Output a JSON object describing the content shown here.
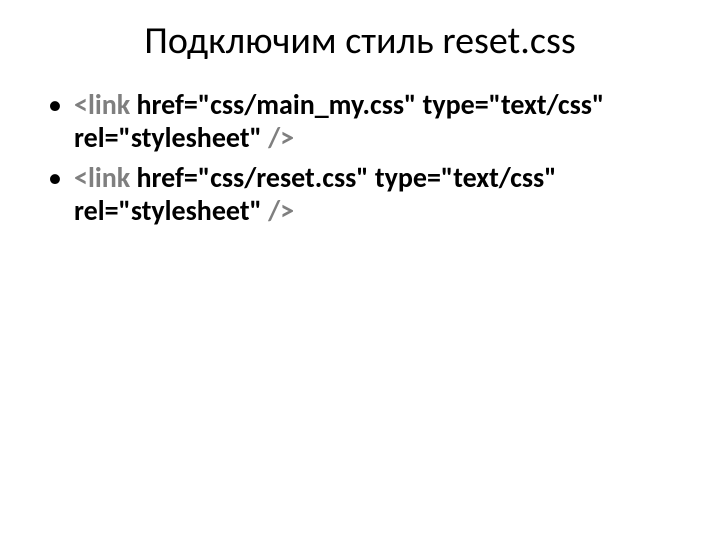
{
  "title": "Подключим стиль reset.css",
  "items": [
    {
      "parts": [
        {
          "cls": "gray",
          "text": "<link"
        },
        {
          "cls": "black",
          "text": " href=\"css/main_my.css\" type=\"text/css\" rel=\"stylesheet\" "
        },
        {
          "cls": "gray",
          "text": "/>"
        }
      ]
    },
    {
      "parts": [
        {
          "cls": "gray",
          "text": "<link"
        },
        {
          "cls": "black",
          "text": " href=\"css/reset.css\" type=\"text/css\" rel=\"stylesheet\" "
        },
        {
          "cls": "gray",
          "text": "/>"
        }
      ]
    }
  ]
}
